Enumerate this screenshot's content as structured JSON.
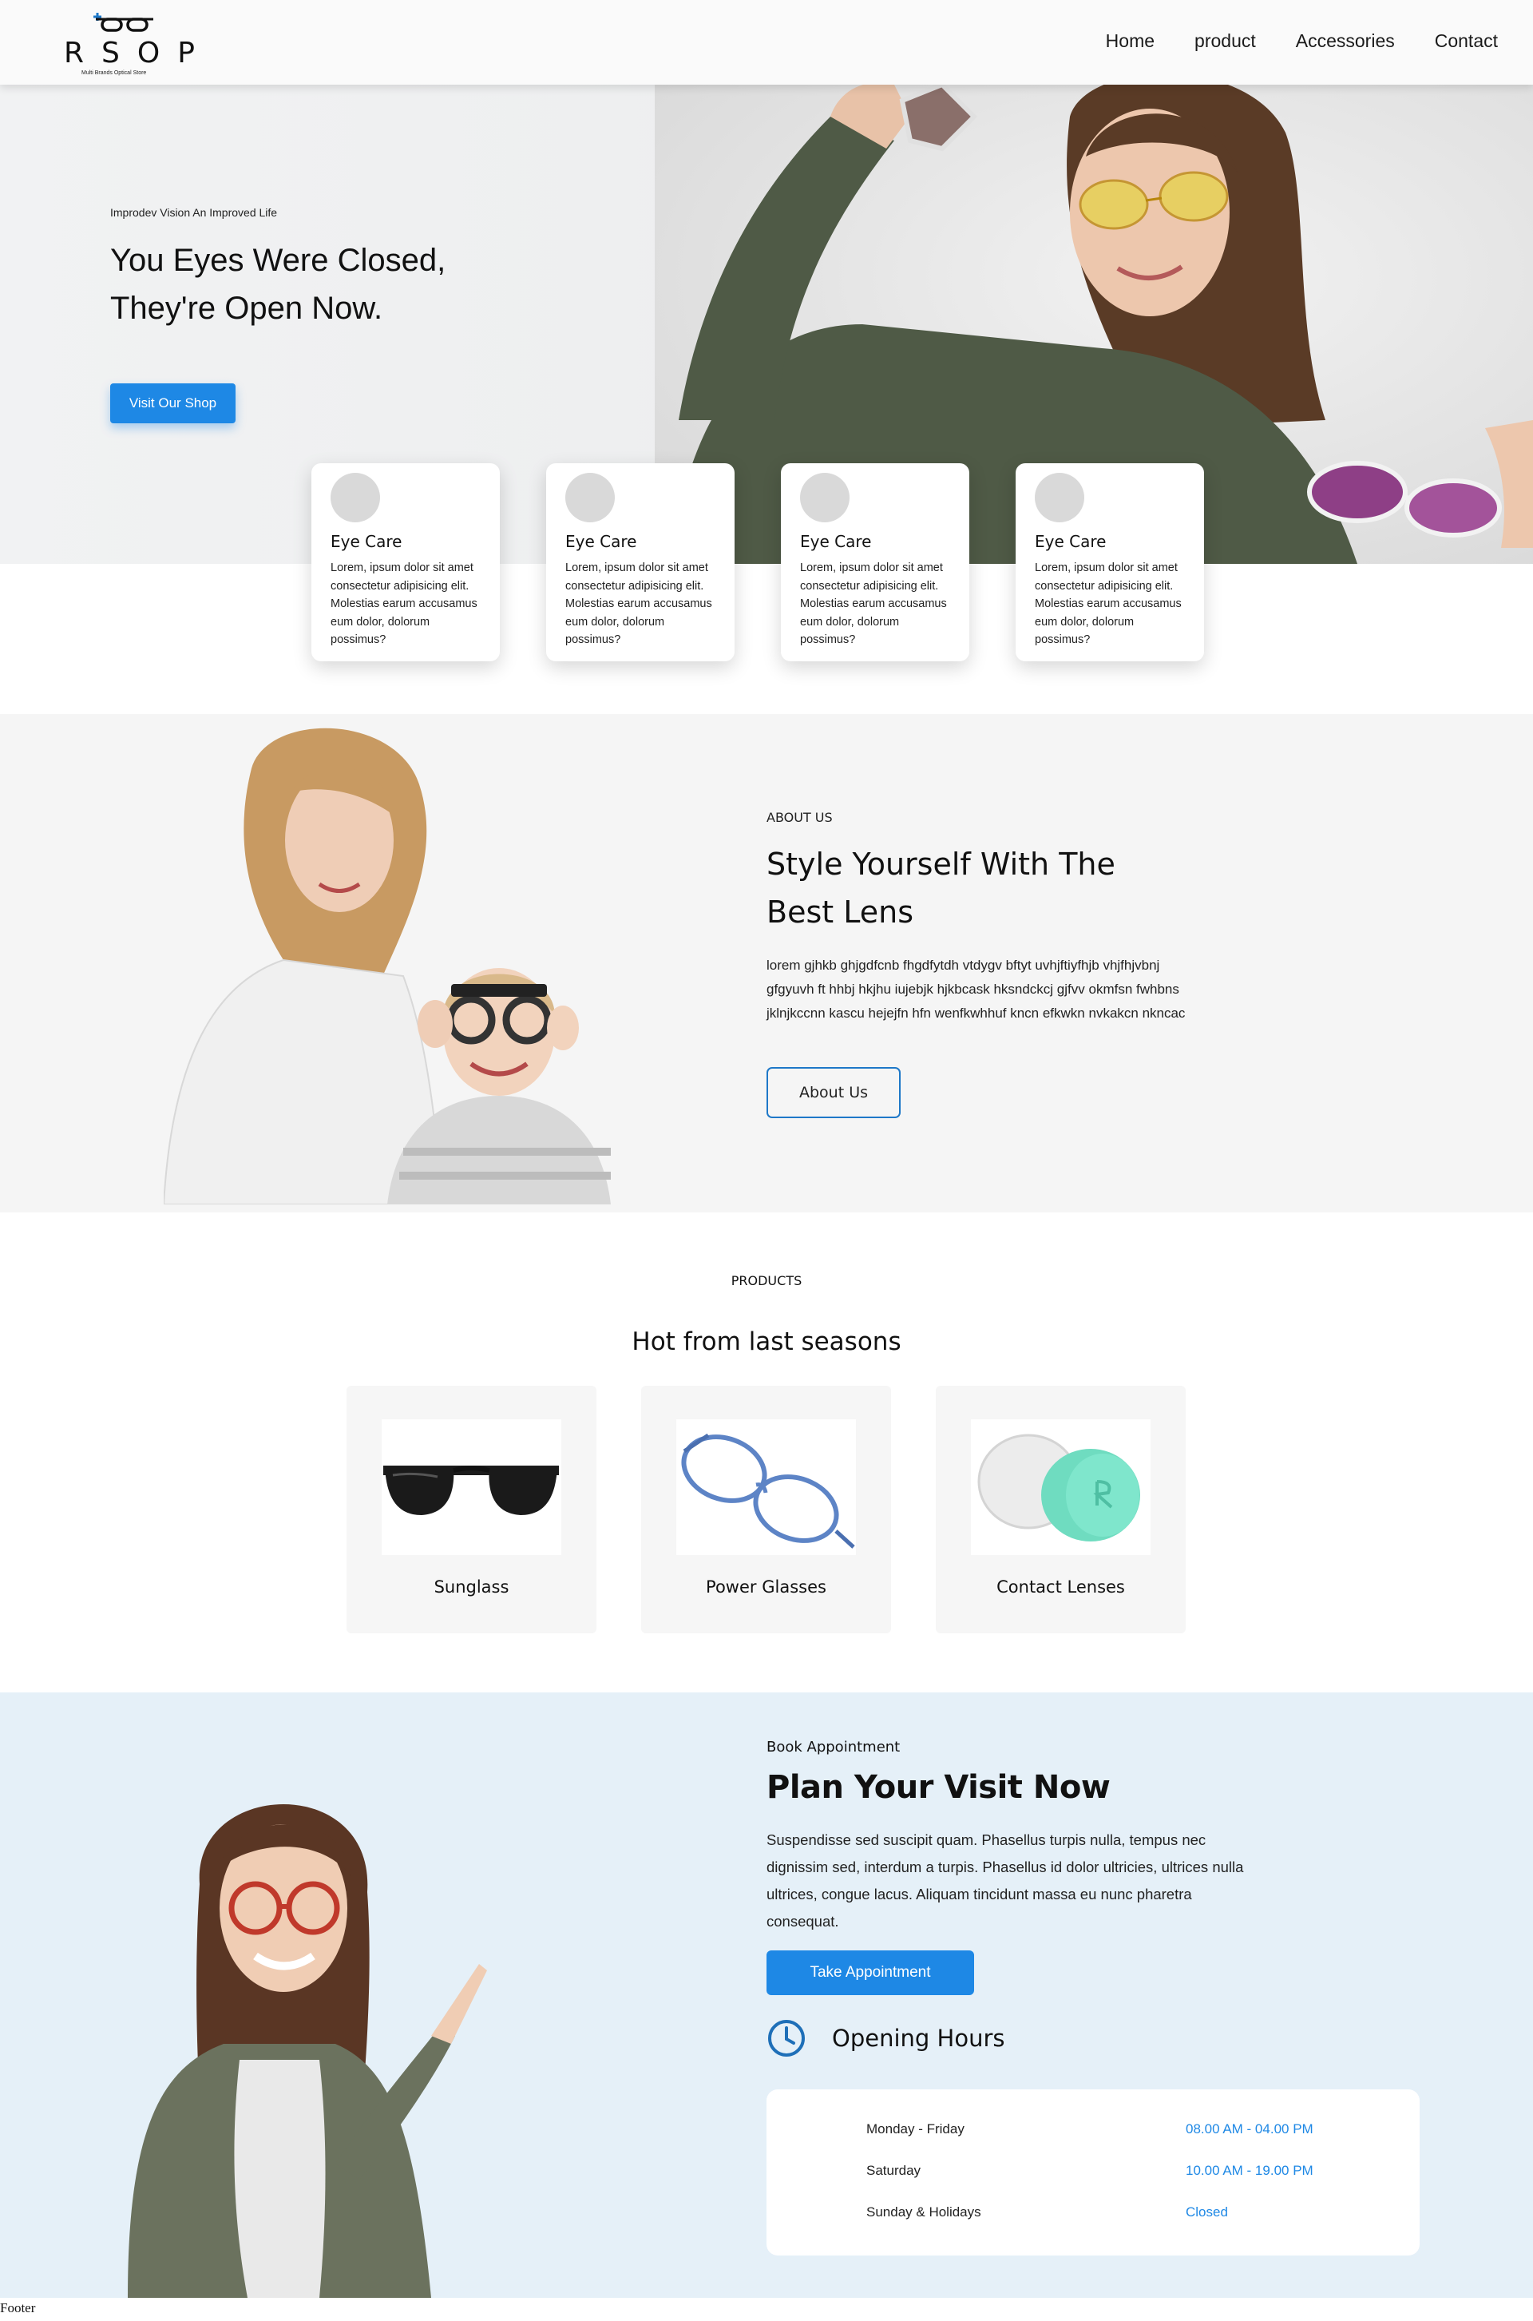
{
  "nav": {
    "logo_letters": "RSOP",
    "logo_subtitle": "Multi Brands Optical Store",
    "links": [
      "Home",
      "product",
      "Accessories",
      "Contact"
    ]
  },
  "hero": {
    "kicker": "Improdev Vision An Improved Life",
    "title": "You Eyes Were Closed, They're Open Now.",
    "button": "Visit Our Shop"
  },
  "services": [
    {
      "title": "Eye Care",
      "text": "Lorem, ipsum dolor sit amet consectetur adipisicing elit. Molestias earum accusamus eum dolor, dolorum possimus?"
    },
    {
      "title": "Eye Care",
      "text": "Lorem, ipsum dolor sit amet consectetur adipisicing elit. Molestias earum accusamus eum dolor, dolorum possimus?"
    },
    {
      "title": "Eye Care",
      "text": "Lorem, ipsum dolor sit amet consectetur adipisicing elit. Molestias earum accusamus eum dolor, dolorum possimus?"
    },
    {
      "title": "Eye Care",
      "text": "Lorem, ipsum dolor sit amet consectetur adipisicing elit. Molestias earum accusamus eum dolor, dolorum possimus?"
    }
  ],
  "about": {
    "kicker": "ABOUT US",
    "title": "Style Yourself With The Best Lens",
    "text": "lorem gjhkb ghjgdfcnb fhgdfytdh vtdygv bftyt uvhjftiyfhjb vhjfhjvbnj gfgyuvh ft hhbj hkjhu iujebjk hjkbcask hksndckcj gjfvv okmfsn fwhbns jklnjkccnn kascu hejejfn hfn wenfkwhhuf kncn efkwkn nvkakcn nkncac",
    "button": "About Us"
  },
  "products": {
    "kicker": "PRODUCTS",
    "title": "Hot from last seasons",
    "items": [
      {
        "label": "Sunglass",
        "icon": "sunglasses-icon"
      },
      {
        "label": "Power Glasses",
        "icon": "eyeglasses-icon"
      },
      {
        "label": "Contact Lenses",
        "icon": "contact-lens-case-icon"
      }
    ]
  },
  "appointment": {
    "kicker": "Book Appointment",
    "title": "Plan Your Visit Now",
    "text": "Suspendisse sed suscipit quam. Phasellus turpis nulla, tempus nec dignissim sed, interdum a turpis. Phasellus id dolor ultricies, ultrices nulla ultrices, congue lacus. Aliquam tincidunt massa eu nunc pharetra consequat.",
    "button": "Take Appointment",
    "hours_title": "Opening Hours",
    "hours": [
      {
        "day": "Monday - Friday",
        "time": "08.00 AM - 04.00 PM"
      },
      {
        "day": "Saturday",
        "time": "10.00 AM - 19.00 PM"
      },
      {
        "day": "Sunday & Holidays",
        "time": "Closed"
      }
    ]
  },
  "footer": "Footer",
  "colors": {
    "accent": "#1e88e5",
    "about_bg": "#f5f5f5",
    "appointment_bg": "#e5f0f8"
  }
}
